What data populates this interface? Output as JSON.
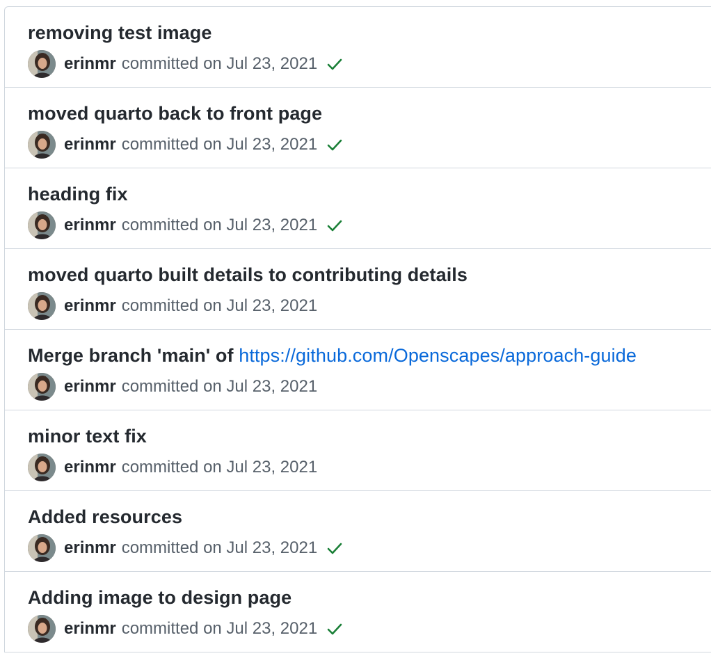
{
  "commits": [
    {
      "title": "removing test image",
      "author": "erinmr",
      "meta": "committed on Jul 23, 2021",
      "status": "success"
    },
    {
      "title": "moved quarto back to front page",
      "author": "erinmr",
      "meta": "committed on Jul 23, 2021",
      "status": "success"
    },
    {
      "title": "heading fix",
      "author": "erinmr",
      "meta": "committed on Jul 23, 2021",
      "status": "success"
    },
    {
      "title": "moved quarto built details to contributing details",
      "author": "erinmr",
      "meta": "committed on Jul 23, 2021",
      "status": "none"
    },
    {
      "title": "Merge branch 'main' of ",
      "link": "https://github.com/Openscapes/approach-guide",
      "author": "erinmr",
      "meta": "committed on Jul 23, 2021",
      "status": "none"
    },
    {
      "title": "minor text fix",
      "author": "erinmr",
      "meta": "committed on Jul 23, 2021",
      "status": "none"
    },
    {
      "title": "Added resources",
      "author": "erinmr",
      "meta": "committed on Jul 23, 2021",
      "status": "success"
    },
    {
      "title": "Adding image to design page",
      "author": "erinmr",
      "meta": "committed on Jul 23, 2021",
      "status": "success"
    }
  ],
  "colors": {
    "title": "#24292f",
    "meta": "#57606a",
    "link": "#0969da",
    "check": "#1a7f37",
    "border": "#d0d7de"
  },
  "icons": {
    "avatar": "avatar-photo",
    "status_success": "check-icon"
  }
}
